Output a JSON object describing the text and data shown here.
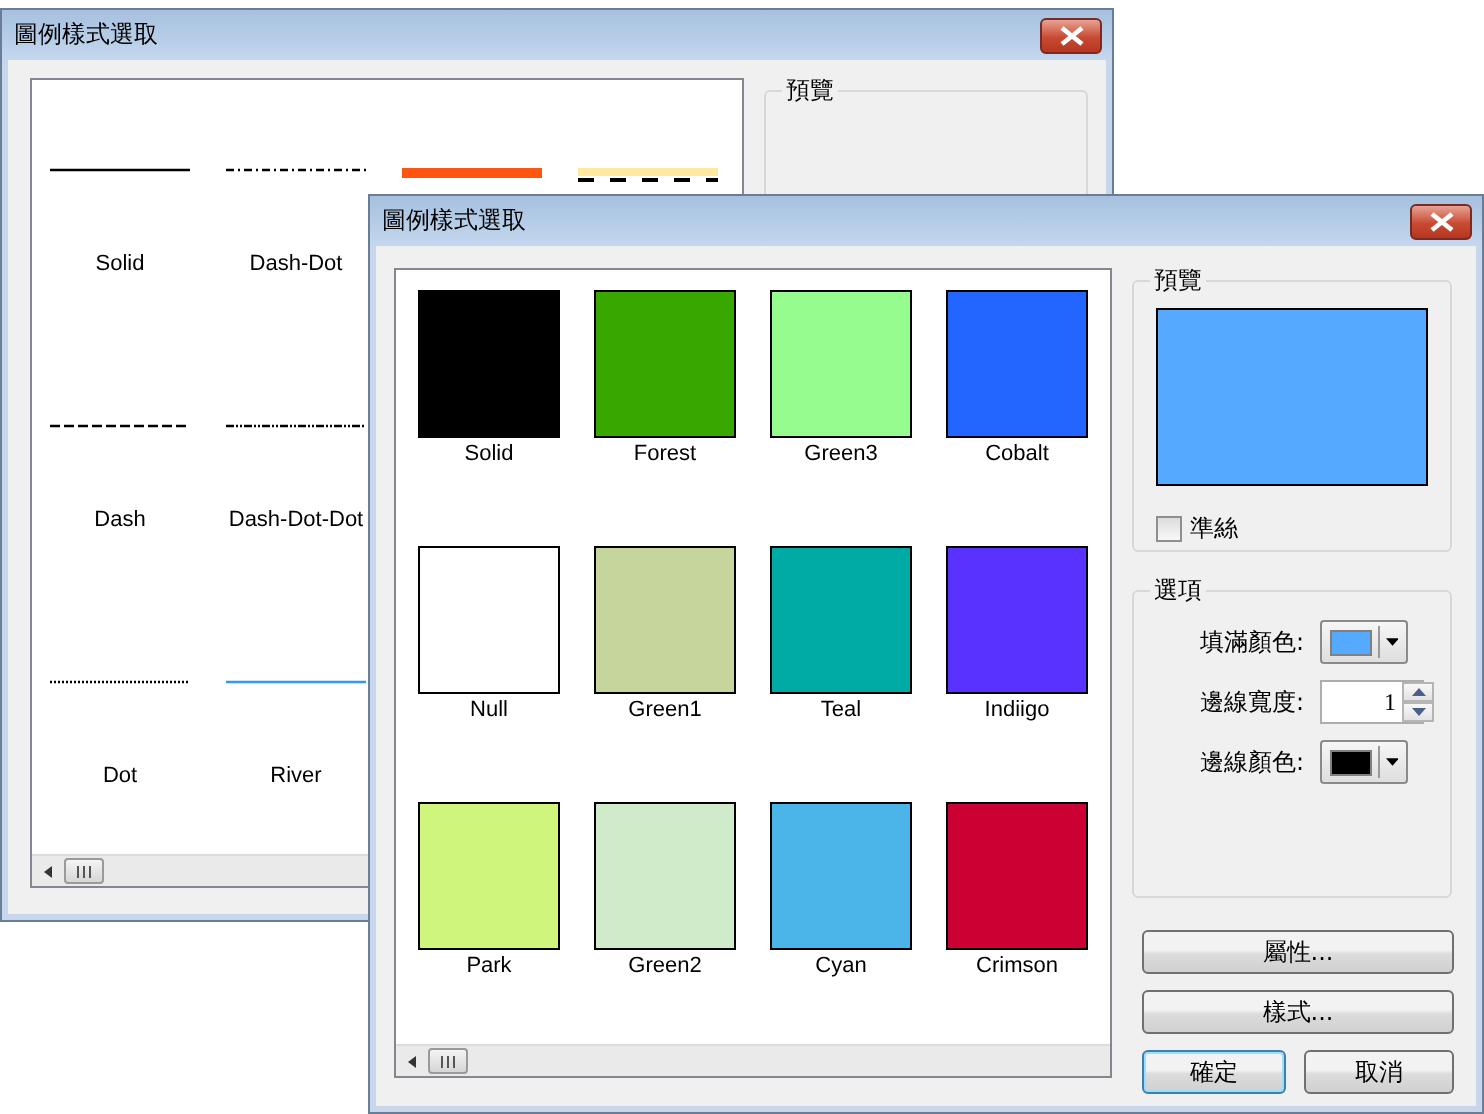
{
  "windows": [
    {
      "kind": "line",
      "title": "圖例樣式選取",
      "rows": [
        [
          {
            "label": "Solid",
            "kind": "solid",
            "color": "#000000"
          },
          {
            "label": "Dash-Dot",
            "kind": "dash-dot",
            "color": "#000000"
          },
          {
            "kind": "thick",
            "color": "#ff5511"
          },
          {
            "kind": "road",
            "color": "#ffe9a0"
          }
        ],
        [
          {
            "label": "Dash",
            "kind": "dash",
            "color": "#000000"
          },
          {
            "label": "Dash-Dot-Dot",
            "kind": "dash-dot-dot",
            "color": "#000000"
          }
        ],
        [
          {
            "label": "Dot",
            "kind": "dot",
            "color": "#000000"
          },
          {
            "label": "River",
            "kind": "solid",
            "color": "#3399ee"
          }
        ]
      ],
      "preview_label": "預覽"
    },
    {
      "kind": "fill",
      "title": "圖例樣式選取",
      "swatches": [
        {
          "label": "Solid",
          "color": "#000000"
        },
        {
          "label": "Forest",
          "color": "#38a800"
        },
        {
          "label": "Green3",
          "color": "#97fc8f"
        },
        {
          "label": "Cobalt",
          "color": "#2266ff"
        },
        {
          "label": "Null",
          "color": "#ffffff"
        },
        {
          "label": "Green1",
          "color": "#c5d59c"
        },
        {
          "label": "Teal",
          "color": "#00aaa5"
        },
        {
          "label": "Indiigo",
          "color": "#5a32ff"
        },
        {
          "label": "Park",
          "color": "#cff57c"
        },
        {
          "label": "Green2",
          "color": "#d0ebc9"
        },
        {
          "label": "Cyan",
          "color": "#4bb4e8"
        },
        {
          "label": "Crimson",
          "color": "#cc0033"
        }
      ],
      "preview": {
        "label": "預覽",
        "color": "#55aaff",
        "checkbox": {
          "label": "準絲",
          "checked": false
        }
      },
      "options": {
        "label": "選項",
        "fields": [
          {
            "kind": "color",
            "label": "填滿顏色:",
            "color": "#55aaff"
          },
          {
            "kind": "number",
            "label": "邊線寬度:",
            "value": "1"
          },
          {
            "kind": "color",
            "label": "邊線顏色:",
            "color": "#000000"
          }
        ]
      },
      "buttons": [
        {
          "label": "屬性...",
          "kind": "wide",
          "focused": false
        },
        {
          "label": "樣式...",
          "kind": "wide",
          "focused": false
        },
        {
          "label": "確定",
          "kind": "half",
          "focused": true
        },
        {
          "label": "取消",
          "kind": "half",
          "focused": false
        }
      ]
    }
  ]
}
